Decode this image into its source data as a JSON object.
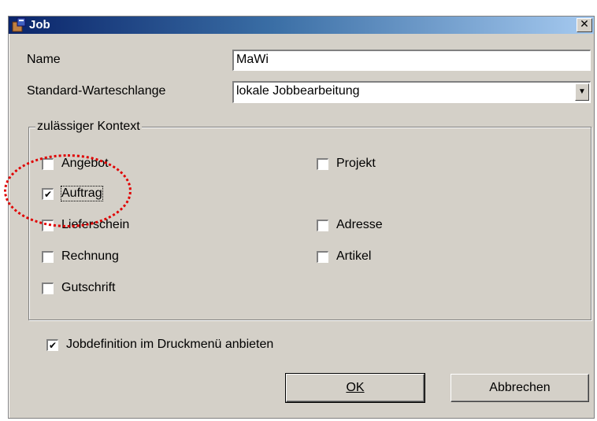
{
  "window": {
    "title": "Job",
    "close_label": "✕"
  },
  "form": {
    "name_label": "Name",
    "name_value": "MaWi",
    "queue_label": "Standard-Warteschlange",
    "queue_value": "lokale Jobbearbeitung",
    "queue_arrow": "▼"
  },
  "context_group": {
    "title": "zulässiger Kontext",
    "left_items": [
      {
        "label": "Angebot",
        "checked": false
      },
      {
        "label": "Auftrag",
        "checked": true
      },
      {
        "label": "Lieferschein",
        "checked": false
      },
      {
        "label": "Rechnung",
        "checked": false
      },
      {
        "label": "Gutschrift",
        "checked": false
      }
    ],
    "right_items": [
      {
        "label": "Projekt",
        "checked": false
      },
      {
        "label": "Adresse",
        "checked": false
      },
      {
        "label": "Artikel",
        "checked": false
      }
    ]
  },
  "print_menu": {
    "label": "Jobdefinition im Druckmenü anbieten",
    "checked": true
  },
  "buttons": {
    "ok_label": "OK",
    "cancel_label": "Abbrechen"
  },
  "check_mark": "✔",
  "colors": {
    "annotation": "#e00000",
    "titlebar": "#0a246a",
    "face": "#d4d0c8"
  }
}
